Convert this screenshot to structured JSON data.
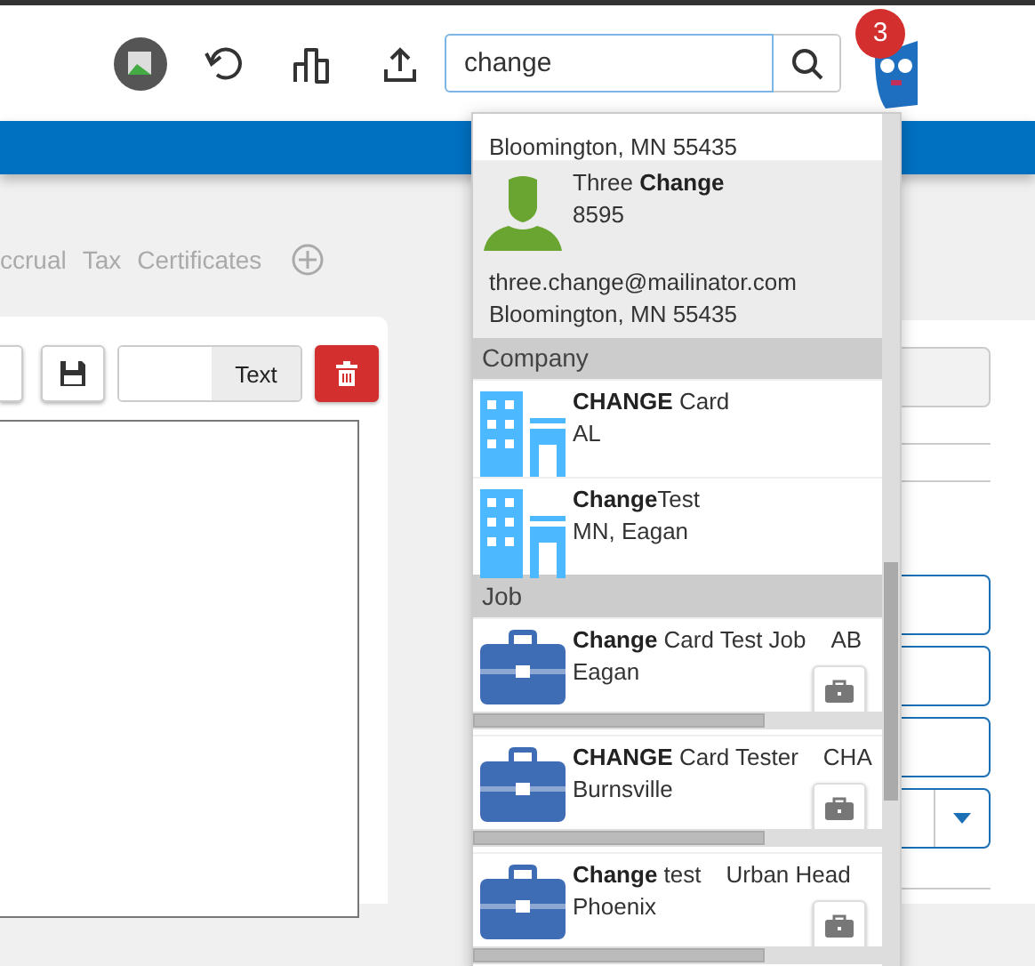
{
  "header": {
    "search": {
      "value": "change"
    },
    "notification_count": "3"
  },
  "tabs": [
    {
      "label": "ccrual"
    },
    {
      "label": "Tax"
    },
    {
      "label": "Certificates"
    }
  ],
  "editor_toolbar": {
    "text_addon": "Text"
  },
  "search_results": {
    "top_partial_line": "Bloomington, MN 55435",
    "groups": [
      {
        "items": [
          {
            "kind": "person",
            "title": "Three **Change**",
            "subtitle": "8595",
            "extra_lines": [
              "three.change@mailinator.com",
              "Bloomington, MN 55435"
            ],
            "highlighted": true
          }
        ]
      },
      {
        "title": "Company",
        "items": [
          {
            "kind": "company",
            "title": "**CHANGE** Card",
            "subtitle": "AL",
            "highlighted": false
          },
          {
            "kind": "company",
            "title": "**Change**Test",
            "subtitle": "MN, Eagan",
            "highlighted": false
          }
        ]
      },
      {
        "title": "Job",
        "items": [
          {
            "kind": "job",
            "title": "**Change** Card Test Job",
            "aside": "AB",
            "subtitle": "Eagan",
            "highlighted": false
          },
          {
            "kind": "job",
            "title": "**CHANGE** Card Tester",
            "aside": "CHA",
            "subtitle": "Burnsville",
            "highlighted": false
          },
          {
            "kind": "job",
            "title": "**Change** test",
            "aside": "Urban Head",
            "subtitle": "Phoenix",
            "highlighted": false
          }
        ]
      }
    ]
  }
}
